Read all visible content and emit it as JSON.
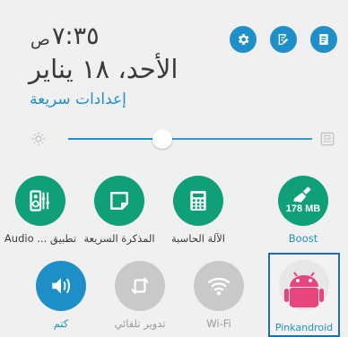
{
  "status": {
    "time": "٧:٣٥",
    "ampm": "ص",
    "date": "الأحد، ١٨ يناير",
    "quick_settings_link": "إعدادات سريعة"
  },
  "top_icons": [
    {
      "name": "settings-icon"
    },
    {
      "name": "edit-icon"
    },
    {
      "name": "list-icon"
    }
  ],
  "brightness": {
    "level_fraction": 0.33
  },
  "tiles_row1": [
    {
      "name": "audio-app",
      "label": "Audio ... تطبيق"
    },
    {
      "name": "quick-memo",
      "label": "المذكرة السريعة"
    },
    {
      "name": "calculator",
      "label": "الآلة الحاسبة"
    },
    {
      "name": "boost",
      "label": "Boost",
      "badge": "178 MB"
    }
  ],
  "tiles_row2": [
    {
      "name": "mute",
      "label": "كتم"
    },
    {
      "name": "auto-rotate",
      "label": "تدوير تلقائي"
    },
    {
      "name": "wifi",
      "label": "Wi-Fi"
    }
  ],
  "app_tile": {
    "label": "Pinkandroid"
  },
  "colors": {
    "accent_blue": "#1f8fc8",
    "accent_green": "#0fa07a",
    "disabled_grey": "#c9c9c9",
    "selection_border": "#1f6fb0",
    "android_pink": "#e6457d"
  }
}
